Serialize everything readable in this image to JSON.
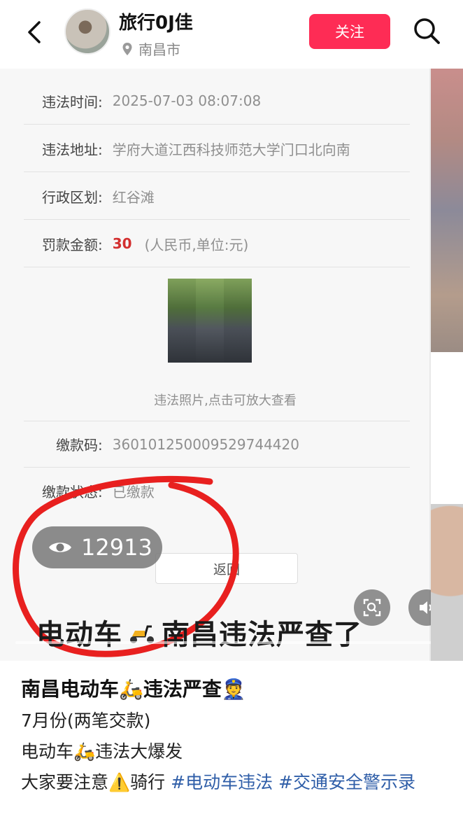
{
  "header": {
    "username": "旅行0J佳",
    "location": "南昌市",
    "follow_label": "关注",
    "icons": {
      "back": "back-arrow-icon",
      "search": "search-icon",
      "location": "location-pin-icon"
    }
  },
  "record": {
    "time_label": "违法时间:",
    "time_value": "2025-07-03 08:07:08",
    "address_label": "违法地址:",
    "address_value": "学府大道江西科技师范大学门口北向南",
    "district_label": "行政区划:",
    "district_value": "红谷滩",
    "fine_label": "罚款金额:",
    "fine_value": "30",
    "fine_unit": "(人民币,单位:元)",
    "photo_caption": "违法照片,点击可放大查看",
    "code_label": "缴款码:",
    "code_value": "360101250009529744420",
    "status_label": "缴款状态:",
    "status_value": "已缴款",
    "back_label": "返回"
  },
  "overlay": {
    "views": "12913",
    "video_text_before": "电动车",
    "video_text_after": "南昌违法严查了"
  },
  "caption": {
    "title_part1": "南昌电动车",
    "title_part2": "违法严查",
    "line1": "7月份(两笔交款)",
    "line2_part1": "电动车",
    "line2_part2": "违法大爆发",
    "line3_part1": "大家要注意",
    "line3_part2": "骑行",
    "tag1": "#电动车违法",
    "tag2": "#交通安全警示录"
  },
  "colors": {
    "accent": "#fe2c55",
    "fine": "#d32f2f",
    "hashtag": "#2f5ea8",
    "circle": "#e8201f"
  }
}
